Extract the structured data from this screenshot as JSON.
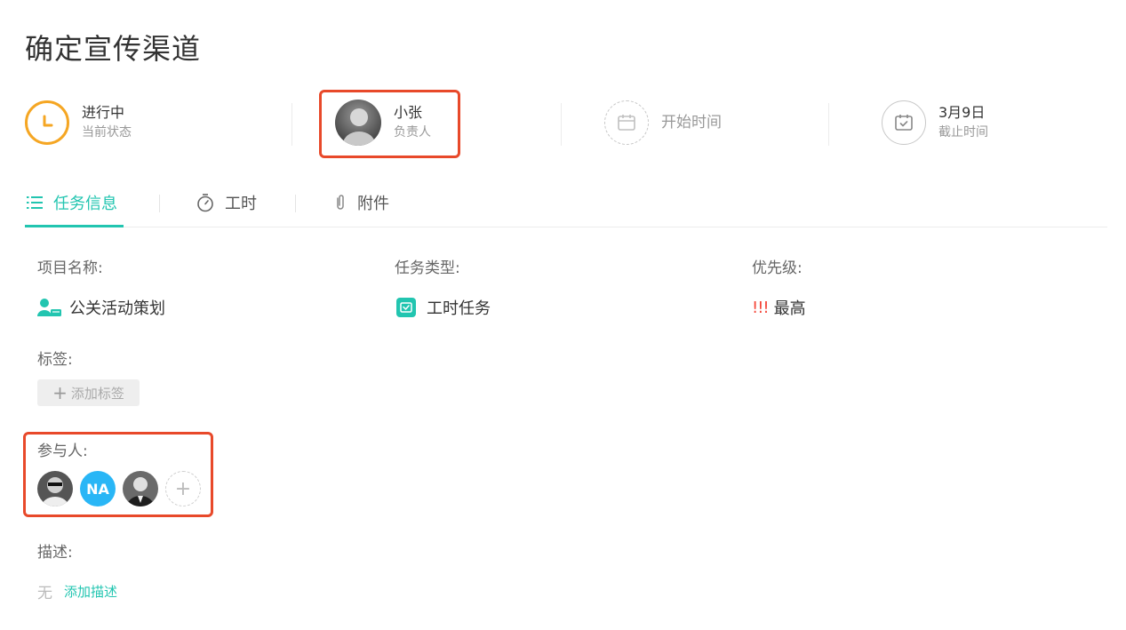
{
  "page": {
    "title": "确定宣传渠道"
  },
  "header": {
    "status": {
      "value": "进行中",
      "label": "当前状态",
      "icon": "clock-icon",
      "color": "#f5a623"
    },
    "assignee": {
      "name": "小张",
      "label": "负责人"
    },
    "start": {
      "label": "开始时间",
      "icon": "calendar-icon"
    },
    "due": {
      "value": "3月9日",
      "label": "截止时间",
      "icon": "calendar-check-icon"
    }
  },
  "tabs": [
    {
      "label": "任务信息",
      "icon": "list-icon",
      "active": true
    },
    {
      "label": "工时",
      "icon": "stopwatch-icon"
    },
    {
      "label": "附件",
      "icon": "paperclip-icon"
    }
  ],
  "fields": {
    "project": {
      "label": "项目名称:",
      "value": "公关活动策划",
      "icon": "project-user-icon"
    },
    "type": {
      "label": "任务类型:",
      "value": "工时任务",
      "icon": "task-type-icon"
    },
    "priority": {
      "label": "优先级:",
      "marks": "!!!",
      "value": "最高",
      "color": "#f44336"
    },
    "tags": {
      "label": "标签:",
      "add_label": "添加标签"
    },
    "members": {
      "label": "参与人:",
      "initials": "NA",
      "add": "+"
    },
    "description": {
      "label": "描述:",
      "empty": "无",
      "add_label": "添加描述"
    }
  },
  "colors": {
    "accent": "#22c5b0",
    "highlight": "#e8492a"
  }
}
